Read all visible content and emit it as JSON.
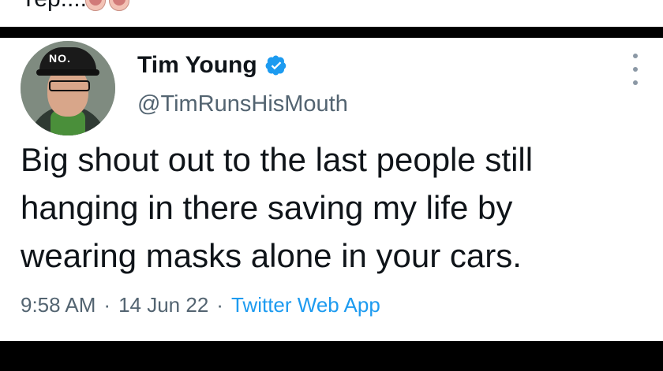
{
  "crop_top_text": "Yep....",
  "tweet": {
    "name": "Tim Young",
    "handle": "@TimRunsHisMouth",
    "avatar_cap_text": "NO.",
    "text": "Big shout out to the last people still hanging in there saving my life by wearing masks alone in your cars.",
    "time": "9:58 AM",
    "separator": "·",
    "date": "14 Jun 22",
    "source": "Twitter Web App",
    "verified_icon": "verified-badge-icon",
    "more_icon": "more-options-icon"
  },
  "colors": {
    "name": "#0f1419",
    "handle": "#536471",
    "link": "#1d9bf0",
    "verified": "#1d9bf0",
    "bars": "#000000"
  }
}
